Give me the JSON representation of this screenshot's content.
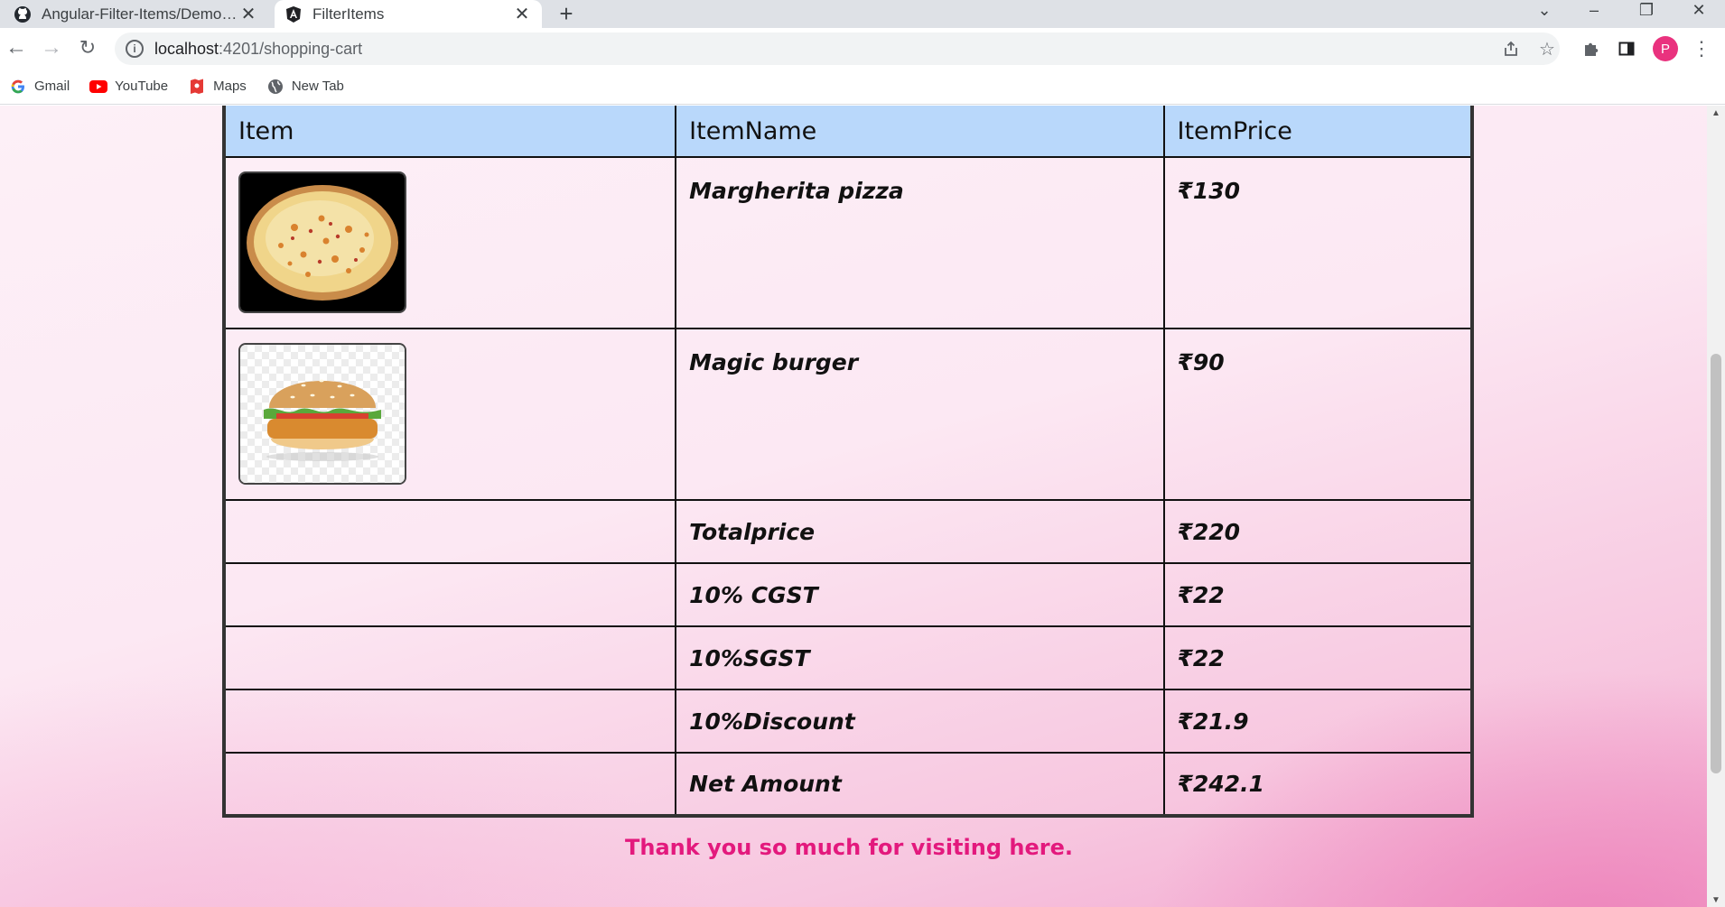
{
  "browser": {
    "tabs": [
      {
        "title": "Angular-Filter-Items/Demo.png a",
        "icon": "github-icon",
        "active": false
      },
      {
        "title": "FilterItems",
        "icon": "angular-icon",
        "active": true
      }
    ],
    "address": {
      "host": "localhost",
      "path": ":4201/shopping-cart"
    },
    "bookmarks": [
      {
        "label": "Gmail",
        "icon": "google-icon"
      },
      {
        "label": "YouTube",
        "icon": "youtube-icon"
      },
      {
        "label": "Maps",
        "icon": "maps-icon"
      },
      {
        "label": "New Tab",
        "icon": "globe-icon"
      }
    ],
    "profile_initial": "P",
    "accent": "#e9327e"
  },
  "cart": {
    "headers": {
      "item": "Item",
      "name": "ItemName",
      "price": "ItemPrice"
    },
    "items": [
      {
        "name": "Margherita pizza",
        "price": "₹130",
        "image": "pizza-image"
      },
      {
        "name": "Magic burger",
        "price": "₹90",
        "image": "burger-image"
      }
    ],
    "summary": [
      {
        "label": "Totalprice",
        "value": "₹220"
      },
      {
        "label": "10% CGST",
        "value": "₹22"
      },
      {
        "label": "10%SGST",
        "value": "₹22"
      },
      {
        "label": "10%Discount",
        "value": "₹21.9"
      },
      {
        "label": "Net Amount",
        "value": "₹242.1"
      }
    ],
    "header_color": "#b9d8fb"
  },
  "footer": {
    "thanks": "Thank you so much for visiting here.",
    "color": "#e3197d"
  }
}
